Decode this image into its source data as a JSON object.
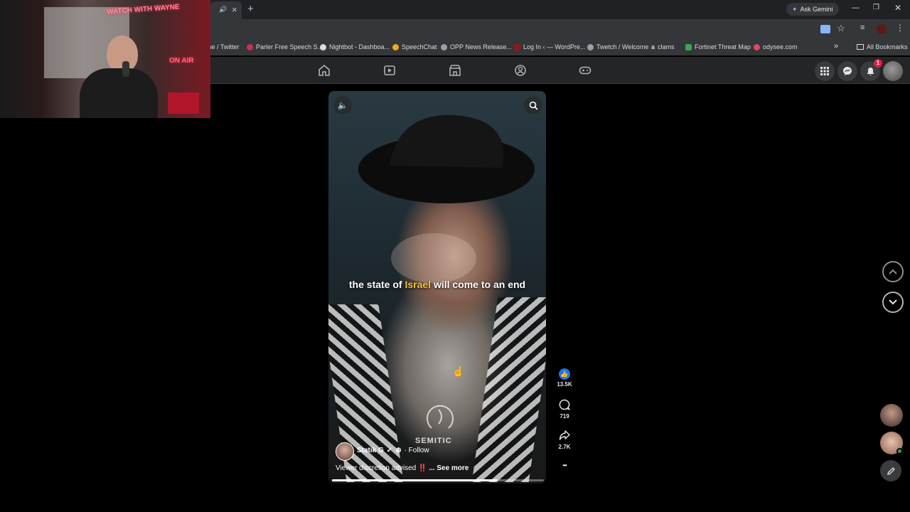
{
  "browser": {
    "tab_close": "×",
    "new_tab": "+",
    "ask_gemini": "Ask Gemini",
    "bookmarks": [
      {
        "label": "me / Twitter",
        "color": "#5f6368"
      },
      {
        "label": "Parler Free Speech S...",
        "color": "#c7334a"
      },
      {
        "label": "Nightbot - Dashboa...",
        "color": "#dadce0"
      },
      {
        "label": "SpeechChat",
        "color": "#f5a623"
      },
      {
        "label": "OPP News Release...",
        "color": "#9aa0a6"
      },
      {
        "label": "Log In ‹ — WordPre...",
        "color": "#8b1a1a"
      },
      {
        "label": "Twetch / Welcome",
        "color": "#9aa0a6"
      },
      {
        "label": "clams",
        "color": "#dadce0"
      },
      {
        "label": "Fortinet Threat Map",
        "color": "#34a853"
      },
      {
        "label": "odysee.com",
        "color": "#e2495b"
      }
    ],
    "all_bookmarks": "All Bookmarks",
    "more_bookmarks": "»"
  },
  "webcam": {
    "sign_top": "WATCH WITH WAYNE",
    "sign_bottom": "ON AIR"
  },
  "facebook": {
    "notification_count": "1"
  },
  "video": {
    "caption_before": "the state of ",
    "caption_highlight": "Israel",
    "caption_after": " will come to an end",
    "watermark": "SEMITIC",
    "author": "Statik G",
    "follow": "· Follow",
    "description": "Viewer discretion advised ",
    "description_emoji": "‼️",
    "see_more": "... See more",
    "progress": 0.78
  },
  "actions": {
    "likes": "13.5K",
    "comments": "719",
    "shares": "2.7K",
    "more": "•••"
  },
  "colors": {
    "accent": "#1877f2",
    "highlight": "#f2c230",
    "badge": "#e41e3f"
  }
}
